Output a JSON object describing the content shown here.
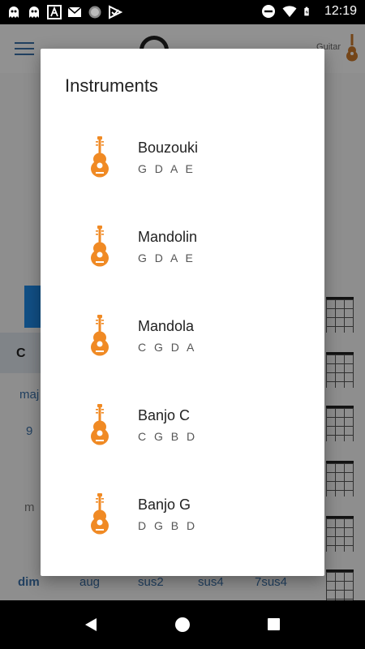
{
  "status_bar": {
    "time": "12:19",
    "icons": [
      "ghost-icon",
      "ghost-icon",
      "a-icon",
      "mail-icon",
      "circle-icon",
      "check-icon"
    ],
    "right_icons": [
      "do-not-disturb-icon",
      "wifi-icon",
      "battery-icon"
    ]
  },
  "app": {
    "header": {
      "instrument_label": "Guitar"
    },
    "chord_root": "C",
    "chord_types_visible": [
      "maj",
      "9",
      "m"
    ],
    "bottom_chord_row": [
      "dim",
      "aug",
      "sus2",
      "sus4",
      "7sus4"
    ]
  },
  "dialog": {
    "title": "Instruments",
    "instruments": [
      {
        "name": "Bouzouki",
        "tuning": "G D A E"
      },
      {
        "name": "Mandolin",
        "tuning": "G D A E"
      },
      {
        "name": "Mandola",
        "tuning": "C G D A"
      },
      {
        "name": "Banjo C",
        "tuning": "C G B D"
      },
      {
        "name": "Banjo G",
        "tuning": "D G B D"
      }
    ],
    "accent_color": "#f08a24"
  },
  "nav_bar": {
    "buttons": [
      "back-icon",
      "home-icon",
      "recents-icon"
    ]
  }
}
